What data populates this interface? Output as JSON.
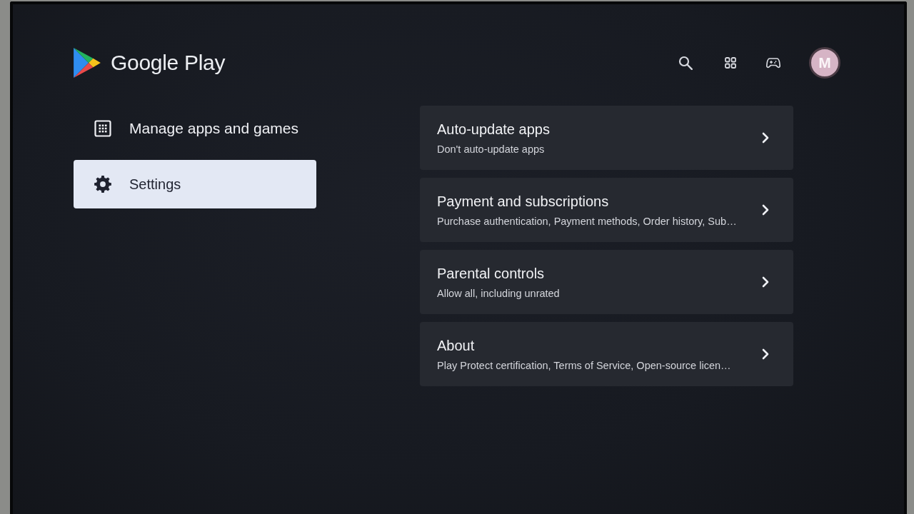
{
  "header": {
    "title": "Google Play",
    "avatar": "M"
  },
  "sidebar": {
    "items": [
      {
        "kind": "manage",
        "label": "Manage apps and games",
        "selected": false
      },
      {
        "kind": "settings",
        "label": "Settings",
        "selected": true
      }
    ]
  },
  "settings": [
    {
      "title": "Auto-update apps",
      "summary": "Don't auto-update apps"
    },
    {
      "title": "Payment and subscriptions",
      "summary": "Purchase authentication, Payment methods, Order history, Sub…"
    },
    {
      "title": "Parental controls",
      "summary": "Allow all, including unrated"
    },
    {
      "title": "About",
      "summary": "Play Protect certification, Terms of Service, Open-source licen…"
    }
  ]
}
